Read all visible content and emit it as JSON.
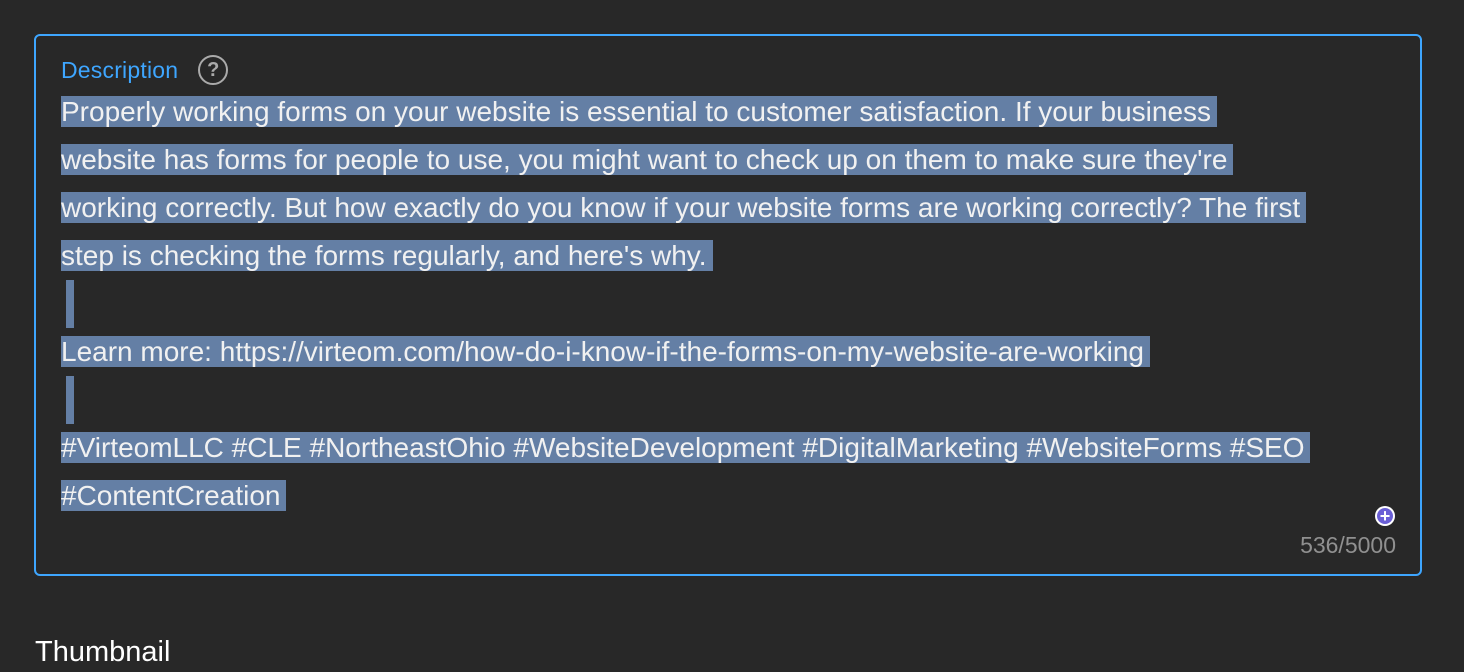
{
  "description": {
    "label": "Description",
    "help_icon": "question-mark-circle-icon",
    "lines": [
      "Properly working forms on your website is essential to customer satisfaction. If your business",
      "website has forms for people to use, you might want to check up on them to make sure they're",
      "working correctly. But how exactly do you know if your website forms are working correctly? The first",
      "step is checking the forms regularly, and here's why.",
      "",
      "Learn more: https://virteom.com/how-do-i-know-if-the-forms-on-my-website-are-working",
      "",
      "#VirteomLLC #CLE #NortheastOhio #WebsiteDevelopment #DigitalMarketing #WebsiteForms #SEO",
      "#ContentCreation"
    ],
    "emoji_icon": "add-emoji-icon",
    "char_count": "536/5000"
  },
  "thumbnail": {
    "heading": "Thumbnail"
  },
  "colors": {
    "accent": "#3ea6ff",
    "selection": "#647fa5",
    "background": "#282828"
  }
}
